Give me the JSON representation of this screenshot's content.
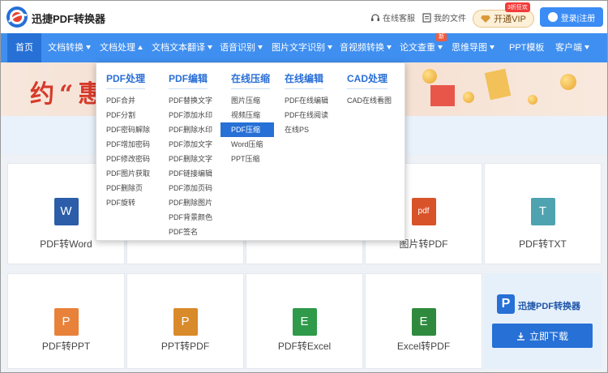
{
  "header": {
    "brand": "迅捷PDF转换器",
    "service_label": "在线客服",
    "files_label": "我的文件",
    "vip_label": "开通VIP",
    "vip_tag": "3折狂欢",
    "login_label": "登录|注册"
  },
  "nav": {
    "items": [
      {
        "label": "首页"
      },
      {
        "label": "文档转换"
      },
      {
        "label": "文档处理"
      },
      {
        "label": "文档文本翻译"
      },
      {
        "label": "语音识别"
      },
      {
        "label": "图片文字识别"
      },
      {
        "label": "音视频转换"
      },
      {
        "label": "论文查重"
      },
      {
        "label": "思维导图"
      },
      {
        "label": "PPT模板"
      },
      {
        "label": "客户端"
      }
    ],
    "new_badge": "新"
  },
  "banner": {
    "text": "约“惠"
  },
  "dropdown": {
    "columns": [
      {
        "title": "PDF处理",
        "items": [
          "PDF合并",
          "PDF分割",
          "PDF密码解除",
          "PDF增加密码",
          "PDF修改密码",
          "PDF图片获取",
          "PDF删除页",
          "PDF旋转"
        ]
      },
      {
        "title": "PDF编辑",
        "items": [
          "PDF替换文字",
          "PDF添加水印",
          "PDF删除水印",
          "PDF添加文字",
          "PDF删除文字",
          "PDF链接编辑",
          "PDF添加页码",
          "PDF删除图片",
          "PDF背景颜色",
          "PDF签名"
        ]
      },
      {
        "title": "在线压缩",
        "items": [
          "图片压缩",
          "视频压缩",
          "PDF压缩",
          "Word压缩",
          "PPT压缩"
        ],
        "active": "PDF压缩"
      },
      {
        "title": "在线编辑",
        "items": [
          "PDF在线编辑",
          "PDF在线阅读",
          "在线PS"
        ]
      },
      {
        "title": "CAD处理",
        "items": [
          "CAD在线看图"
        ]
      }
    ]
  },
  "cards": {
    "row1": [
      {
        "label": "PDF转Word",
        "icon": "W",
        "color": "#2b5da8"
      },
      {
        "label": "图片转PDF",
        "icon": "pdf",
        "color": "#d9532a"
      },
      {
        "label": "PDF转TXT",
        "icon": "T",
        "color": "#4fa3b0"
      }
    ],
    "row2": [
      {
        "label": "PDF转PPT",
        "icon": "P",
        "color": "#e8823a"
      },
      {
        "label": "PPT转PDF",
        "icon": "P",
        "color": "#d98a2a"
      },
      {
        "label": "PDF转Excel",
        "icon": "E",
        "color": "#2f9a4a"
      },
      {
        "label": "Excel转PDF",
        "icon": "E",
        "color": "#2f8a3e"
      }
    ]
  },
  "promo": {
    "name": "迅捷PDF转换器",
    "logo": "P",
    "download_label": "立即下载"
  }
}
